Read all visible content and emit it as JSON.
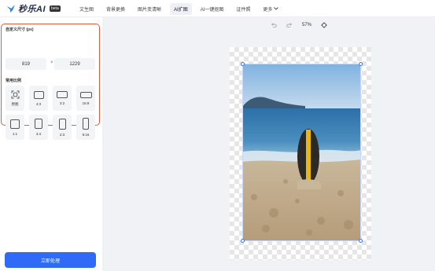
{
  "app": {
    "logo_text": "秒乐AI",
    "logo_badge": "beta"
  },
  "nav": {
    "items": [
      "文生图",
      "背景更换",
      "图片变清晰",
      "AI扩图",
      "AI一键抠图",
      "证件照"
    ],
    "active": "AI扩图",
    "more_label": "更多"
  },
  "sidebar": {
    "custom_size_label": "自定义尺寸 (px)",
    "width_value": "819",
    "x_sign": "×",
    "height_value": "1229",
    "ratio_label": "常用比例",
    "ratios": [
      "原图",
      "4:3",
      "3:2",
      "16:9",
      "1:1",
      "3:4",
      "2:3",
      "9:16"
    ],
    "process_button": "立即处理"
  },
  "toolbar": {
    "undo_icon": "undo-icon",
    "redo_icon": "redo-icon",
    "zoom": "57%",
    "fit_icon": "target-icon"
  },
  "colors": {
    "accent": "#2f6bf6",
    "highlight_border": "#e35a3c"
  }
}
